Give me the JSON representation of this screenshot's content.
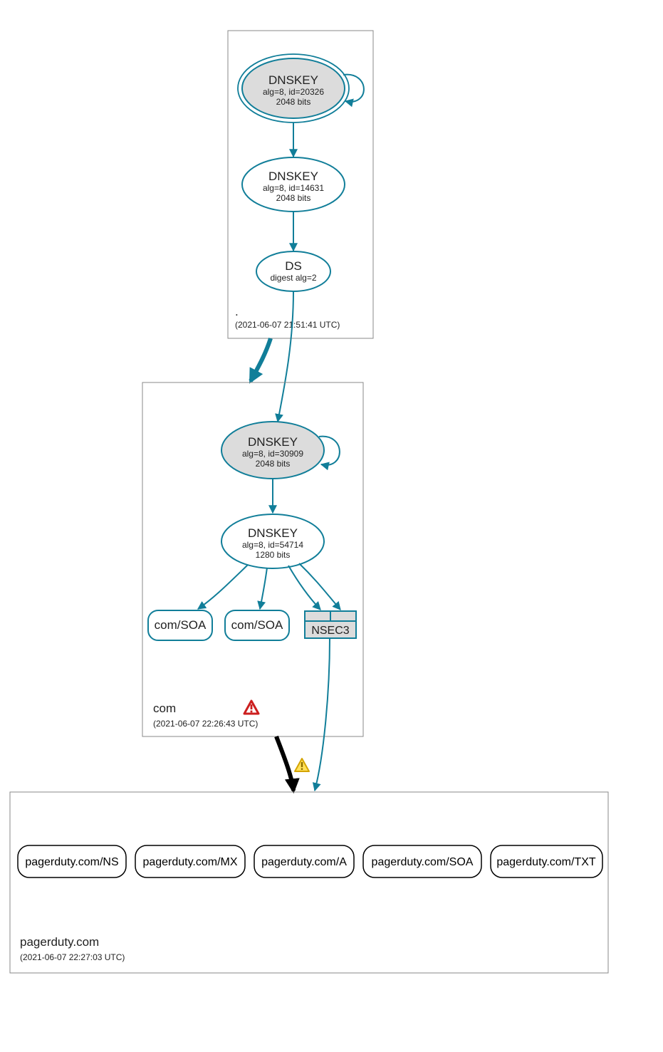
{
  "zones": {
    "root": {
      "name": ".",
      "timestamp": "(2021-06-07 21:51:41 UTC)",
      "dnskey_ksk": {
        "title": "DNSKEY",
        "alg": "alg=8, id=20326",
        "bits": "2048 bits"
      },
      "dnskey_zsk": {
        "title": "DNSKEY",
        "alg": "alg=8, id=14631",
        "bits": "2048 bits"
      },
      "ds": {
        "title": "DS",
        "alg": "digest alg=2"
      }
    },
    "com": {
      "name": "com",
      "timestamp": "(2021-06-07 22:26:43 UTC)",
      "dnskey_ksk": {
        "title": "DNSKEY",
        "alg": "alg=8, id=30909",
        "bits": "2048 bits"
      },
      "dnskey_zsk": {
        "title": "DNSKEY",
        "alg": "alg=8, id=54714",
        "bits": "1280 bits"
      },
      "soa1": "com/SOA",
      "soa2": "com/SOA",
      "nsec3": "NSEC3"
    },
    "pagerduty": {
      "name": "pagerduty.com",
      "timestamp": "(2021-06-07 22:27:03 UTC)",
      "records": {
        "ns": "pagerduty.com/NS",
        "mx": "pagerduty.com/MX",
        "a": "pagerduty.com/A",
        "soa": "pagerduty.com/SOA",
        "txt": "pagerduty.com/TXT"
      }
    }
  },
  "icons": {
    "error": "error-triangle",
    "warning": "warning-triangle"
  },
  "colors": {
    "teal": "#117e99",
    "grey_fill": "#dcdcdc",
    "box_stroke": "#888888"
  }
}
